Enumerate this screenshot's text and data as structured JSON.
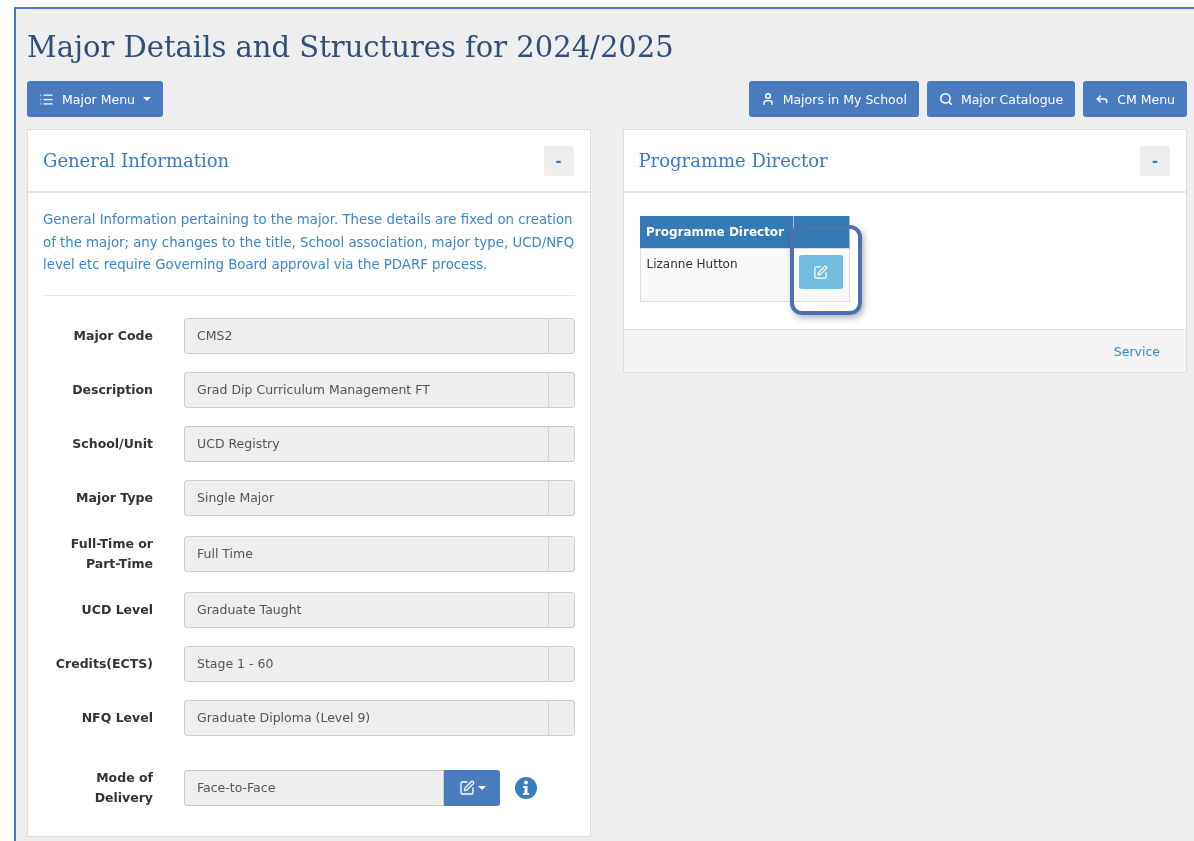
{
  "title": "Major Details and Structures for 2024/2025",
  "major_menu": {
    "label": "Major Menu"
  },
  "header_buttons": [
    {
      "label": "Majors in My School"
    },
    {
      "label": "Major Catalogue"
    },
    {
      "label": "CM Menu"
    }
  ],
  "general_panel": {
    "title": "General Information",
    "collapse": "-",
    "description": "General Information pertaining to the major. These details are fixed on creation of the major; any changes to the title, School association, major type, UCD/NFQ level etc require Governing Board approval via the PDARF process.",
    "fields": [
      {
        "label": "Major Code",
        "value": "CMS2"
      },
      {
        "label": "Description",
        "value": "Grad Dip Curriculum Management FT"
      },
      {
        "label": "School/Unit",
        "value": "UCD Registry"
      },
      {
        "label": "Major Type",
        "value": "Single Major"
      },
      {
        "label": "Full-Time or Part-Time",
        "value": "Full Time"
      },
      {
        "label": "UCD Level",
        "value": "Graduate Taught"
      },
      {
        "label": "Credits(ECTS)",
        "value": "Stage 1 - 60"
      },
      {
        "label": "NFQ Level",
        "value": "Graduate Diploma (Level 9)"
      }
    ],
    "mode_of_delivery": {
      "label": "Mode of Delivery",
      "value": "Face-to-Face"
    }
  },
  "director_panel": {
    "title": "Programme Director",
    "collapse": "-",
    "columns": [
      "Programme Director"
    ],
    "rows": [
      {
        "name": "Lizanne Hutton"
      }
    ],
    "footer_link": "Service"
  }
}
